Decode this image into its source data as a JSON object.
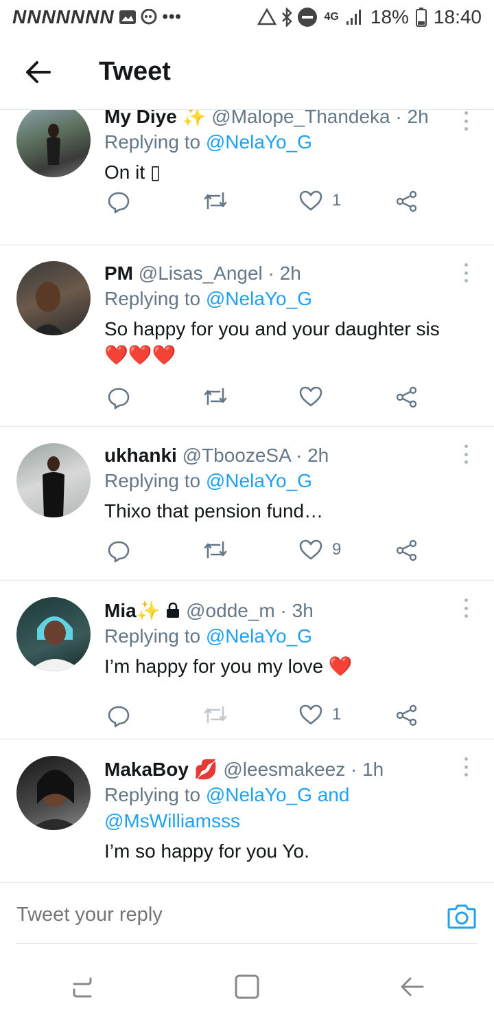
{
  "status_bar": {
    "left_text": "NNNNNNN",
    "network": "4G",
    "battery": "18%",
    "time": "18:40"
  },
  "header": {
    "title": "Tweet"
  },
  "tweets": [
    {
      "name": "My Diye",
      "name_emoji": "✨",
      "handle": "@Malope_Thandeka",
      "time": "· 2h",
      "replying_prefix": "Replying to",
      "mentions": [
        "@NelaYo_G"
      ],
      "text": "On it ▯",
      "likes": "1"
    },
    {
      "name": "PM",
      "name_emoji": "",
      "handle": "@Lisas_Angel",
      "time": "· 2h",
      "replying_prefix": "Replying to",
      "mentions": [
        "@NelaYo_G"
      ],
      "text": "So happy for you and your daughter sis",
      "text_emoji": "❤️❤️❤️",
      "likes": ""
    },
    {
      "name": "ukhanki",
      "name_emoji": "",
      "handle": "@TboozeSA",
      "time": "· 2h",
      "replying_prefix": "Replying to",
      "mentions": [
        "@NelaYo_G"
      ],
      "text": "Thixo that pension fund…",
      "likes": "9"
    },
    {
      "name": "Mia",
      "name_emoji": "✨",
      "handle": "@odde_m",
      "time": "· 3h",
      "replying_prefix": "Replying to",
      "mentions": [
        "@NelaYo_G"
      ],
      "text": "I’m happy for you my love",
      "text_emoji": "❤️",
      "likes": "1",
      "protected": true
    },
    {
      "name": "MakaBoy",
      "name_emoji": "💋",
      "handle": "@leesmakeez",
      "time": "· 1h",
      "replying_prefix": "Replying to",
      "mentions": [
        "@NelaYo_G",
        "and",
        "@MsWilliamsss"
      ],
      "text": "I’m so happy for you Yo."
    }
  ],
  "reply_box": {
    "placeholder": "Tweet your reply"
  },
  "colors": {
    "accent": "#1da1f2",
    "muted": "#657786",
    "divider": "#e1e8ed"
  }
}
